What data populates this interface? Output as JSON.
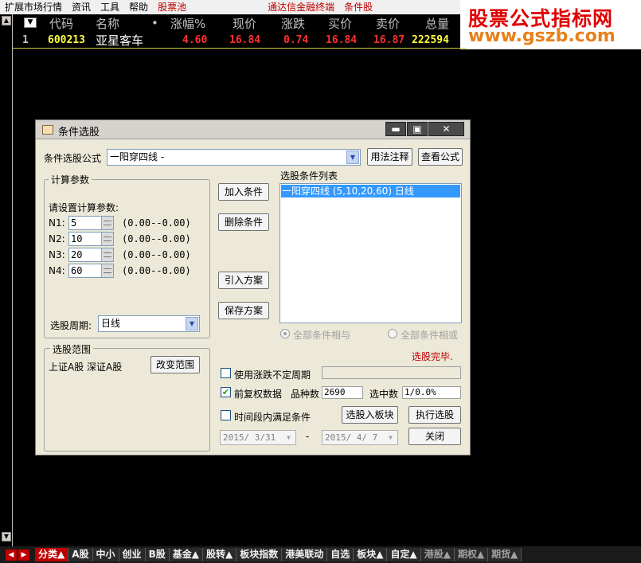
{
  "menubar": {
    "items": [
      "扩展市场行情",
      "资讯",
      "工具",
      "帮助",
      "股票池"
    ],
    "center_items": [
      "通达信金融终端",
      "条件股"
    ]
  },
  "banner": {
    "line1": "股票公式指标网",
    "line2": "www.gszb.com"
  },
  "quote": {
    "headers": {
      "code": "代码",
      "name": "名称",
      "dot": "•",
      "pct": "涨幅%",
      "price": "现价",
      "change": "涨跌",
      "bid": "买价",
      "ask": "卖价",
      "volume": "总量"
    },
    "row": {
      "index": "1",
      "code": "600213",
      "name": "亚星客车",
      "pct": "4.60",
      "price": "16.84",
      "change": "0.74",
      "bid": "16.84",
      "ask": "16.87",
      "volume": "222594"
    }
  },
  "dialog": {
    "title": "条件选股",
    "formula_label": "条件选股公式",
    "formula_value": "一阳穿四线   -",
    "usage_button": "用法注释",
    "view_formula_button": "查看公式",
    "params_group": "计算参数",
    "params_prompt": "请设置计算参数:",
    "params": [
      {
        "label": "N1:",
        "value": "5",
        "range": "(0.00--0.00)"
      },
      {
        "label": "N2:",
        "value": "10",
        "range": "(0.00--0.00)"
      },
      {
        "label": "N3:",
        "value": "20",
        "range": "(0.00--0.00)"
      },
      {
        "label": "N4:",
        "value": "60",
        "range": "(0.00--0.00)"
      }
    ],
    "period_label": "选股周期:",
    "period_value": "日线",
    "add_condition": "加入条件",
    "delete_condition": "删除条件",
    "import_plan": "引入方案",
    "save_plan": "保存方案",
    "list_title": "选股条件列表",
    "list_items": [
      "一阳穿四线 (5,10,20,60) 日线"
    ],
    "radio_and": "全部条件相与",
    "radio_or": "全部条件相或",
    "status": "选股完毕.",
    "scope_group": "选股范围",
    "scope_value": "上证A股 深证A股",
    "change_scope": "改变范围",
    "use_uncertain": "使用涨跌不定周期",
    "pre_adjust": "前复权数据",
    "count_label": "品种数",
    "count_value": "2690",
    "selected_label": "选中数",
    "selected_value": "1/0.0%",
    "timeframe": "时间段内满足条件",
    "to_block": "选股入板块",
    "execute": "执行选股",
    "close": "关闭",
    "date_from": "2015/ 3/31",
    "date_sep": "-",
    "date_to": "2015/ 4/ 7"
  },
  "tabs": [
    "分类▲",
    "A股",
    "中小",
    "创业",
    "B股",
    "基金▲",
    "股转▲",
    "板块指数",
    "港美联动",
    "自选",
    "板块▲",
    "自定▲",
    "港股▲",
    "期权▲",
    "期货▲"
  ],
  "colors": {
    "up_red": "#ff3030",
    "code_yellow": "#ffff40",
    "name_white": "#ffffff",
    "volume_yellow": "#ffff40",
    "header_gray": "#c0c0c0",
    "tab_active": "#c00000"
  }
}
